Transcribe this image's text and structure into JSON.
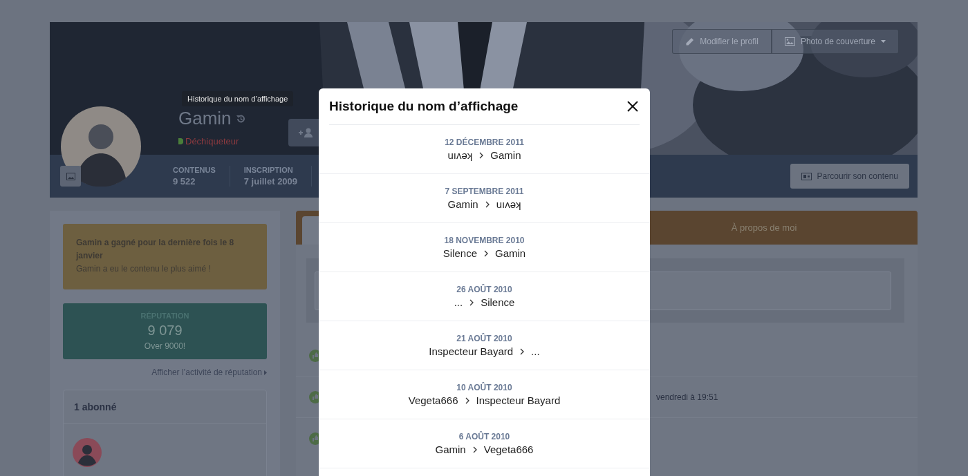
{
  "cover": {
    "buttons": [
      {
        "label": "Modifier le profil",
        "dropdown": false
      },
      {
        "label": "Photo de couverture",
        "dropdown": true
      }
    ]
  },
  "profile": {
    "tooltip": "Historique du nom d’affichage",
    "name": "Gamin",
    "rank": "Déchiqueteur",
    "stats": [
      {
        "label": "CONTENUS",
        "value": "9 522"
      },
      {
        "label": "INSCRIPTION",
        "value": "7 juillet 2009"
      }
    ],
    "browse_button": "Parcourir son contenu"
  },
  "sidebar": {
    "leaderboard": {
      "title": "Gamin a gagné pour la dernière fois le 8 janvier",
      "text": "Gamin a eu le contenu le plus aimé !"
    },
    "reputation": {
      "label": "RÉPUTATION",
      "value": "9 079",
      "caption": "Over 9000!"
    },
    "reputation_link": "Afficher l’activité de réputation",
    "followers": {
      "title": "1 abonné"
    }
  },
  "main": {
    "tabs": [
      {
        "selected": true
      },
      {
        "label": "À propos de moi",
        "selected": false
      }
    ],
    "activity": [
      {
        "kind": "reaction"
      },
      {
        "kind": "reaction",
        "meta": "vendredi à 19:51"
      },
      {
        "kind": "reaction"
      }
    ]
  },
  "modal": {
    "title": "Historique du nom d’affichage",
    "entries": [
      {
        "date": "12 DÉCEMBRE 2011",
        "from": "uıʌǝʞ",
        "to": "Gamin"
      },
      {
        "date": "7 SEPTEMBRE 2011",
        "from": "Gamin",
        "to": "uıʌǝʞ"
      },
      {
        "date": "18 NOVEMBRE 2010",
        "from": "Silence",
        "to": "Gamin"
      },
      {
        "date": "26 AOÛT 2010",
        "from": "...",
        "to": "Silence"
      },
      {
        "date": "21 AOÛT 2010",
        "from": "Inspecteur Bayard",
        "to": "..."
      },
      {
        "date": "10 AOÛT 2010",
        "from": "Vegeta666",
        "to": "Inspecteur Bayard"
      },
      {
        "date": "6 AOÛT 2010",
        "from": "Gamin",
        "to": "Vegeta666"
      }
    ]
  }
}
